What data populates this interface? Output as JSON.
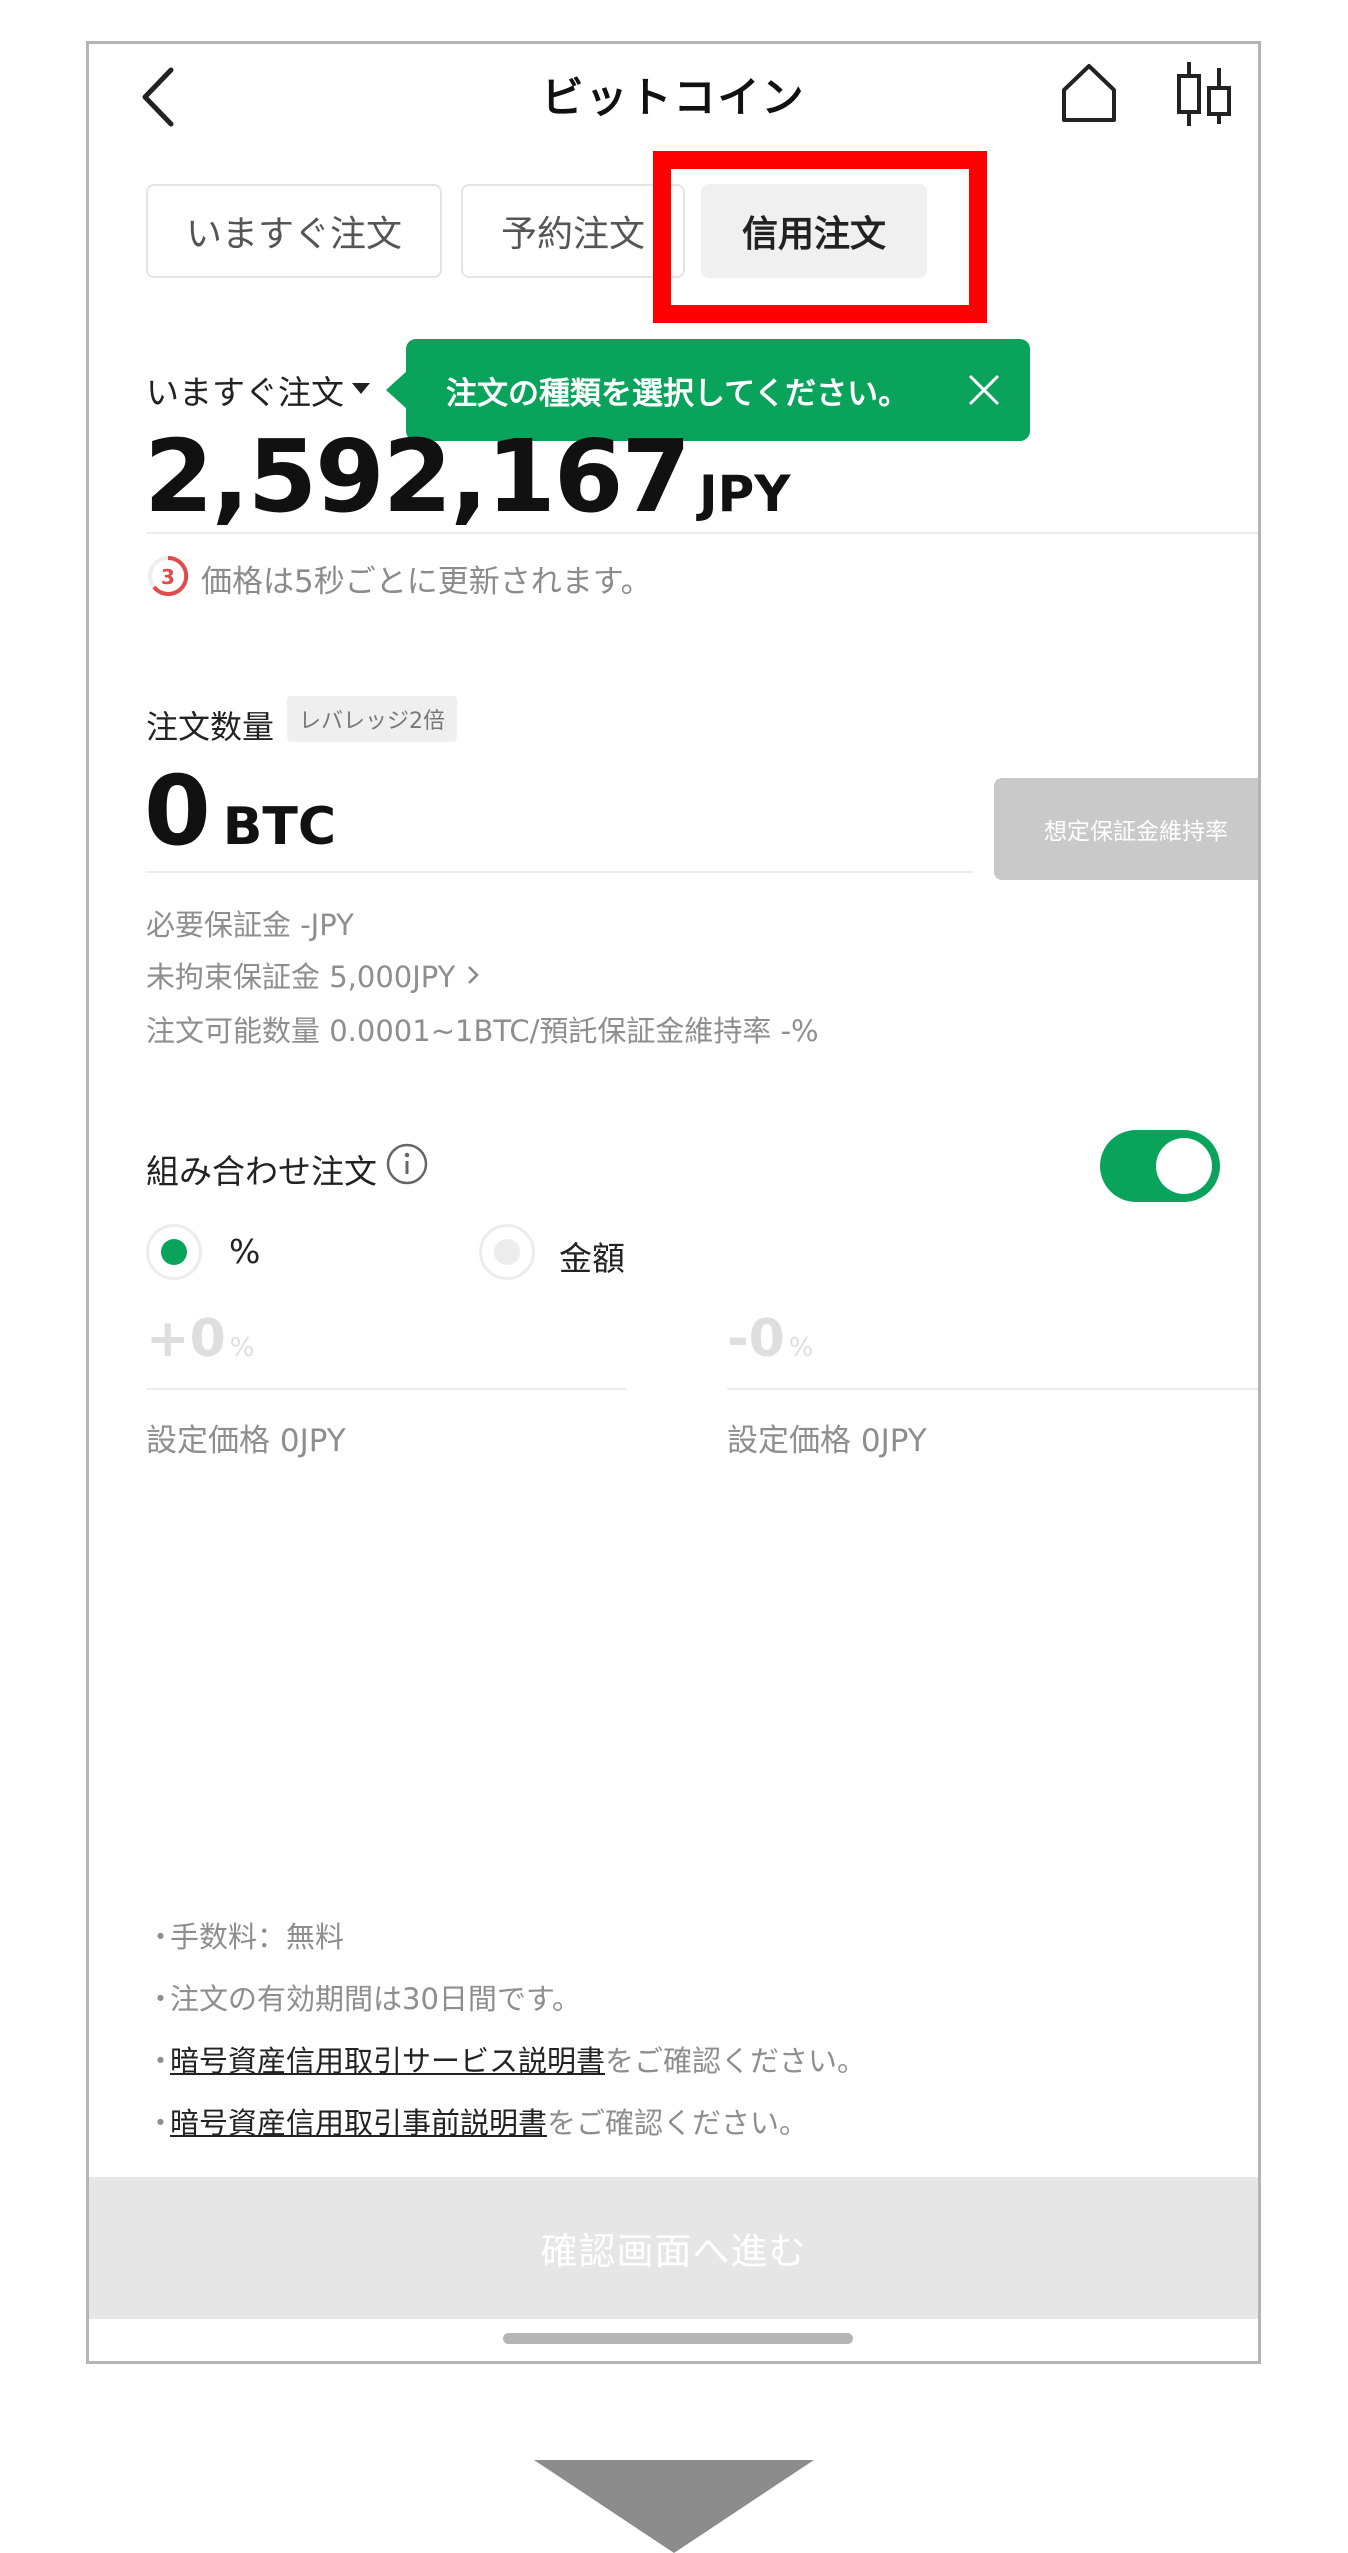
{
  "header": {
    "title": "ビットコイン",
    "back_icon": "chevron-left-icon",
    "home_icon": "home-icon",
    "chart_icon": "candlestick-chart-icon"
  },
  "tabs": [
    {
      "label": "いますぐ注文",
      "selected": false
    },
    {
      "label": "予約注文",
      "selected": false
    },
    {
      "label": "信用注文",
      "selected": true
    }
  ],
  "order": {
    "type_label": "いますぐ注文",
    "tooltip": "注文の種類を選択してください。",
    "price": "2,592,167",
    "price_unit": "JPY",
    "refresh_count": "3",
    "refresh_note": "価格は5秒ごとに更新されます。"
  },
  "quantity": {
    "label": "注文数量",
    "leverage": "レバレッジ2倍",
    "value": "0",
    "unit": "BTC",
    "margin_button": "想定保証金維持率",
    "required_margin": "必要保証金 -JPY",
    "free_margin": "未拘束保証金 5,000JPY",
    "available": "注文可能数量 0.0001~1BTC/預託保証金維持率 -%"
  },
  "combo": {
    "label": "組み合わせ注文",
    "toggle_on": true,
    "radio_percent": "%",
    "radio_amount": "金額",
    "plus_value": "+0",
    "minus_value": "-0",
    "pct_unit": "%",
    "set_price_plus": "設定価格 0JPY",
    "set_price_minus": "設定価格 0JPY"
  },
  "notes": {
    "bullet": "・",
    "fee": "手数料：無料",
    "validity": "注文の有効期間は30日間です。",
    "link1": "暗号資産信用取引サービス説明書",
    "link1_suffix": "をご確認ください。",
    "link2": "暗号資産信用取引事前説明書",
    "link2_suffix": "をご確認ください。"
  },
  "footer": {
    "confirm_label": "確認画面へ進む"
  },
  "colors": {
    "accent_green": "#0aa35c",
    "highlight_red": "#ff0000",
    "disabled_gray": "#c9c9c9"
  }
}
